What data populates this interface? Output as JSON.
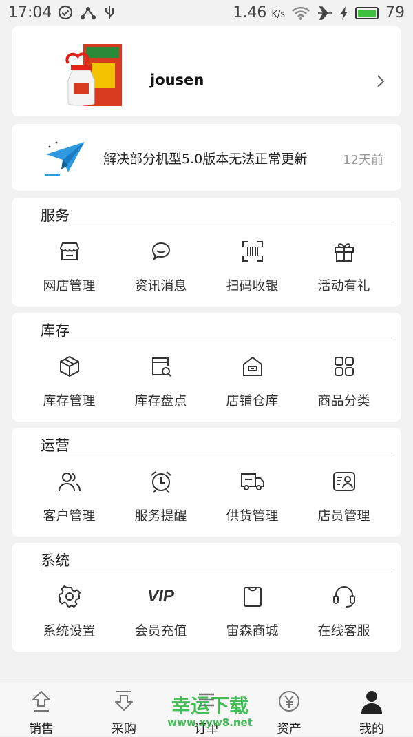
{
  "status_bar": {
    "time": "17:04",
    "net_speed": "1.46",
    "net_unit": "K/s",
    "battery": "79",
    "battery_color": "#3ec23e"
  },
  "profile": {
    "username": "jousen"
  },
  "news": {
    "title": "解决部分机型5.0版本无法正常更新",
    "time": "12天前"
  },
  "sections": [
    {
      "title": "服务",
      "items": [
        {
          "label": "网店管理",
          "icon": "storefront-icon"
        },
        {
          "label": "资讯消息",
          "icon": "chat-bubble-icon"
        },
        {
          "label": "扫码收银",
          "icon": "barcode-scan-icon"
        },
        {
          "label": "活动有礼",
          "icon": "gift-icon"
        }
      ]
    },
    {
      "title": "库存",
      "items": [
        {
          "label": "库存管理",
          "icon": "box-icon"
        },
        {
          "label": "库存盘点",
          "icon": "inventory-search-icon"
        },
        {
          "label": "店铺仓库",
          "icon": "warehouse-icon"
        },
        {
          "label": "商品分类",
          "icon": "grid-icon"
        }
      ]
    },
    {
      "title": "运营",
      "items": [
        {
          "label": "客户管理",
          "icon": "users-icon"
        },
        {
          "label": "服务提醒",
          "icon": "alarm-clock-icon"
        },
        {
          "label": "供货管理",
          "icon": "delivery-truck-icon"
        },
        {
          "label": "店员管理",
          "icon": "staff-card-icon"
        }
      ]
    },
    {
      "title": "系统",
      "items": [
        {
          "label": "系统设置",
          "icon": "gear-icon"
        },
        {
          "label": "会员充值",
          "icon": "vip-icon",
          "icon_text": "VIP"
        },
        {
          "label": "宙森商城",
          "icon": "shopping-bag-icon"
        },
        {
          "label": "在线客服",
          "icon": "headset-icon"
        }
      ]
    }
  ],
  "tabbar": {
    "tabs": [
      {
        "label": "销售",
        "icon": "upload-arrow-icon"
      },
      {
        "label": "采购",
        "icon": "download-arrow-icon"
      },
      {
        "label": "订单",
        "icon": "list-icon"
      },
      {
        "label": "资产",
        "icon": "yen-icon"
      },
      {
        "label": "我的",
        "icon": "person-icon",
        "active": true
      }
    ]
  },
  "watermark": {
    "text": "幸运下载",
    "url": "www.xyw8.net",
    "color": "#27b33a"
  }
}
